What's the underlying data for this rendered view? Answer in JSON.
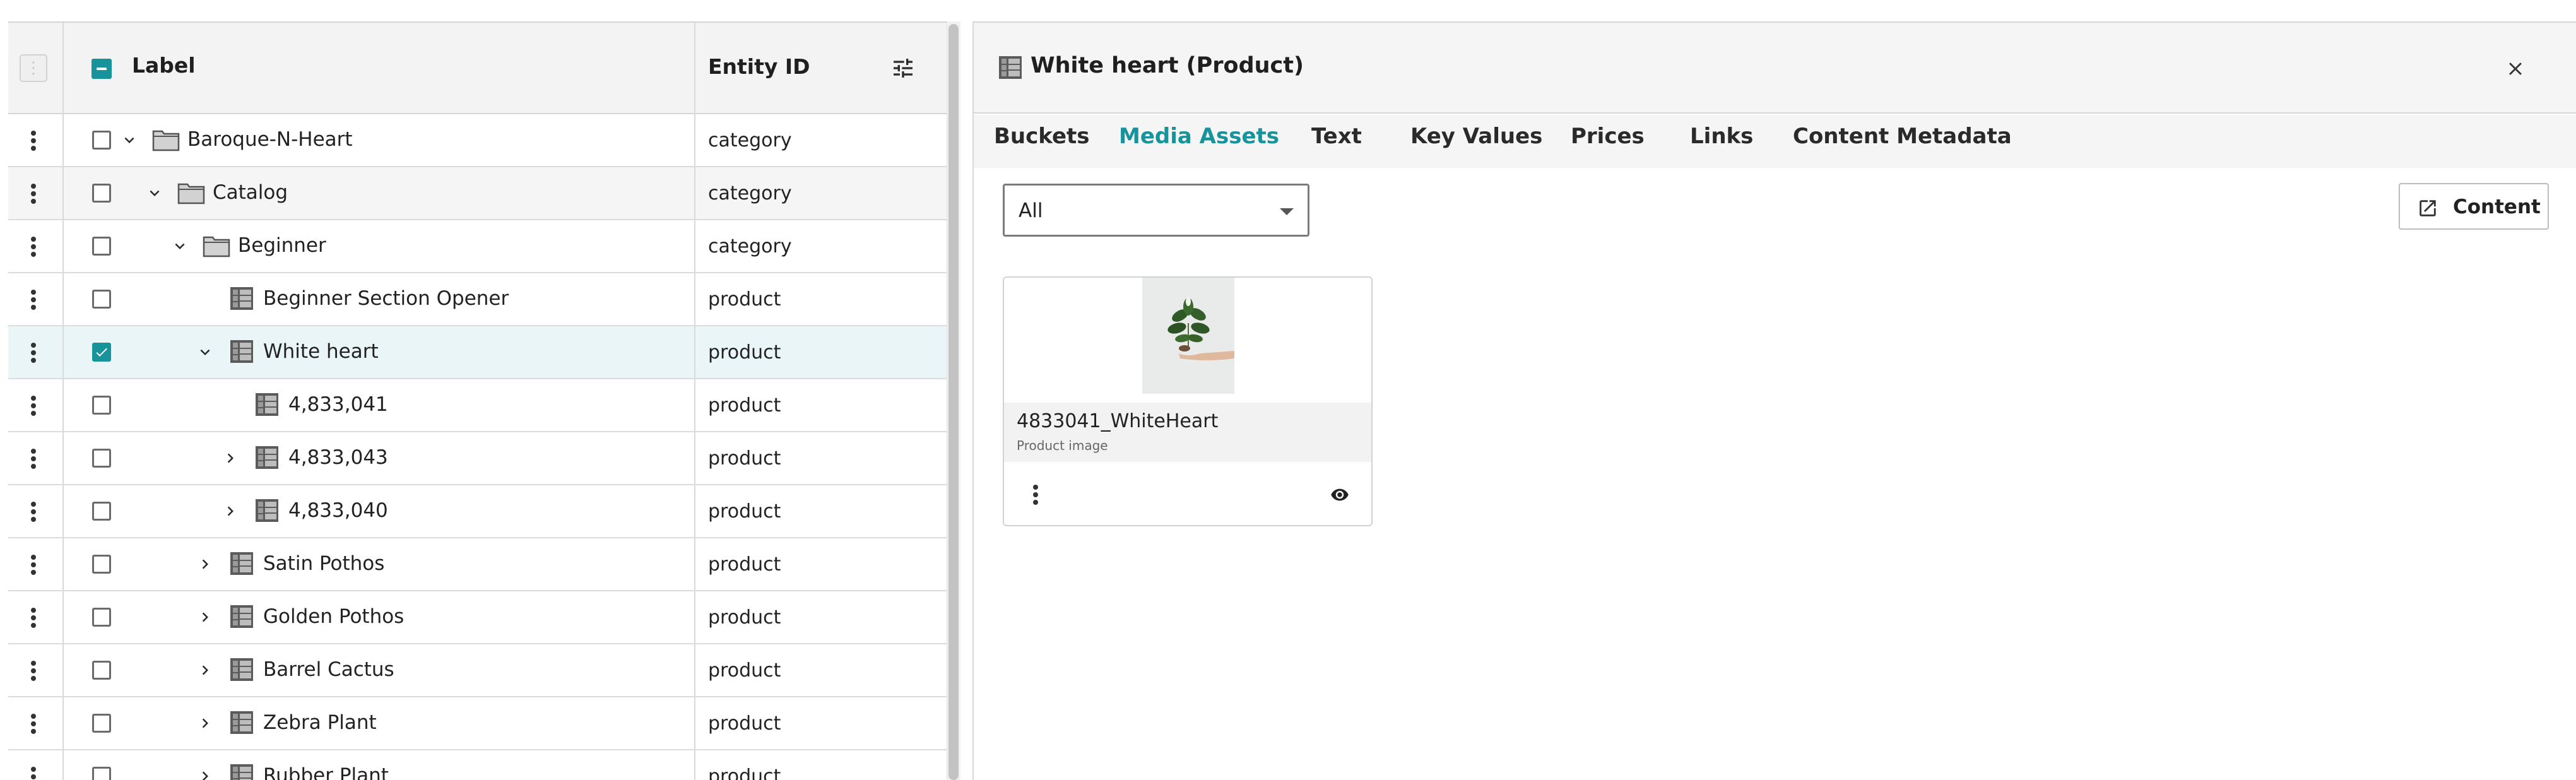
{
  "grid": {
    "header": {
      "label": "Label",
      "entity": "Entity ID"
    },
    "rows": [
      {
        "label": "Baroque-N-Heart",
        "entity": "category"
      },
      {
        "label": "Catalog",
        "entity": "category"
      },
      {
        "label": "Beginner",
        "entity": "category"
      },
      {
        "label": "Beginner Section Opener",
        "entity": "product"
      },
      {
        "label": "White heart",
        "entity": "product"
      },
      {
        "label": "4,833,041",
        "entity": "product"
      },
      {
        "label": "4,833,043",
        "entity": "product"
      },
      {
        "label": "4,833,040",
        "entity": "product"
      },
      {
        "label": "Satin Pothos",
        "entity": "product"
      },
      {
        "label": "Golden Pothos",
        "entity": "product"
      },
      {
        "label": "Barrel Cactus",
        "entity": "product"
      },
      {
        "label": "Zebra Plant",
        "entity": "product"
      },
      {
        "label": "Rubber Plant",
        "entity": "product"
      }
    ]
  },
  "panel": {
    "title": "White heart (Product)",
    "tabs": [
      "Buckets",
      "Media Assets",
      "Text",
      "Key Values",
      "Prices",
      "Links",
      "Content Metadata"
    ],
    "active_tab": "Media Assets",
    "filter_value": "All",
    "content_button": "Content",
    "asset": {
      "name": "4833041_WhiteHeart",
      "type": "Product image"
    }
  },
  "colors": {
    "accent": "#16939b",
    "selected_row": "#e9f5f6"
  },
  "icons": {
    "row_menu": "more-vert-icon",
    "tune": "tune-icon",
    "folder": "folder-icon",
    "product": "product-grid-icon",
    "expand": "chevron-icon",
    "close": "close-icon",
    "open_external": "open-in-new-icon",
    "preview": "eye-icon"
  }
}
